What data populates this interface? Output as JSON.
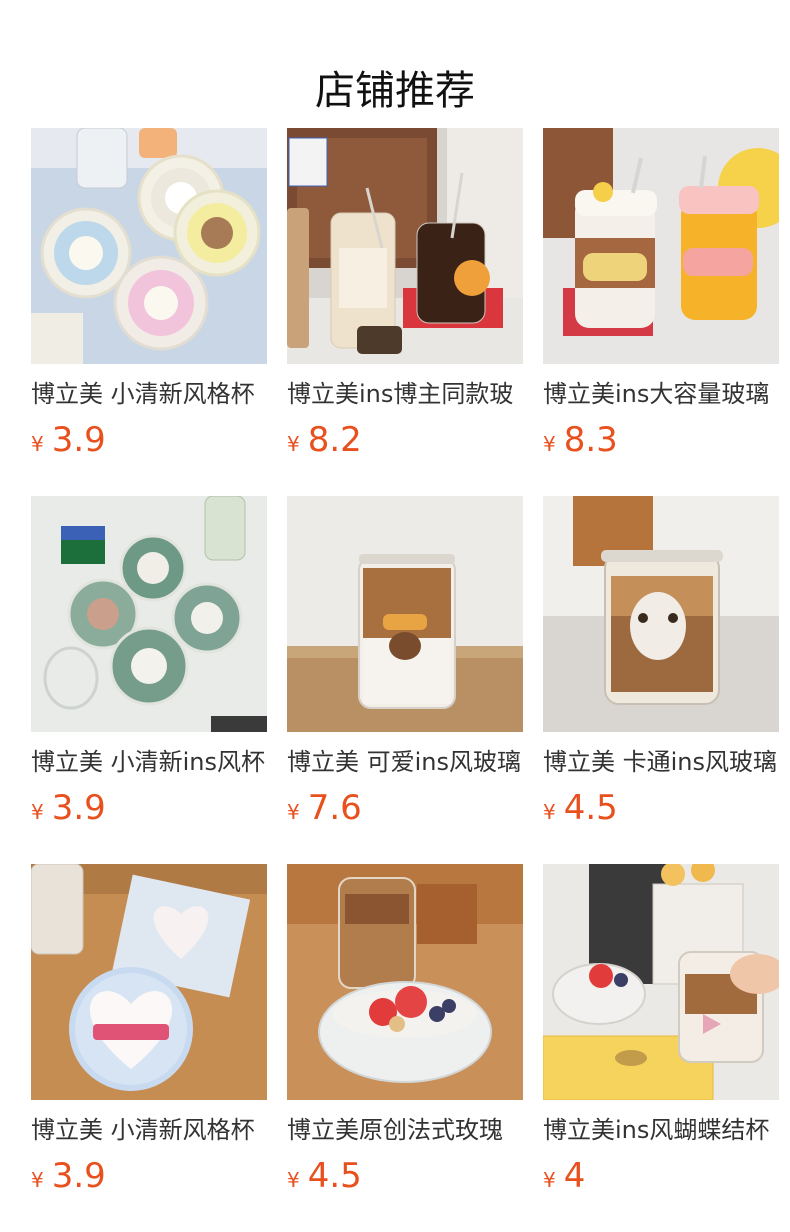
{
  "header": {
    "title": "店铺推荐"
  },
  "currency_symbol": "¥",
  "products": [
    {
      "name": "博立美 小清新风格杯",
      "price": "3.9",
      "image": "coasters-bear-pastel"
    },
    {
      "name": "博立美ins博主同款玻",
      "price": "8.2",
      "image": "glass-bottles-straw"
    },
    {
      "name": "博立美ins大容量玻璃",
      "price": "8.3",
      "image": "ohoh-lettering-cups"
    },
    {
      "name": "博立美 小清新ins风杯",
      "price": "3.9",
      "image": "coasters-green-dogs"
    },
    {
      "name": "博立美 可爱ins风玻璃",
      "price": "7.6",
      "image": "glass-puppy-latte"
    },
    {
      "name": "博立美 卡通ins风玻璃",
      "price": "4.5",
      "image": "glass-upside-dog"
    },
    {
      "name": "博立美 小清新风格杯",
      "price": "3.9",
      "image": "coasters-gingham-heart"
    },
    {
      "name": "博立美原创法式玫瑰",
      "price": "4.5",
      "image": "glass-bowl-strawberry"
    },
    {
      "name": "博立美ins风蝴蝶结杯",
      "price": "4",
      "image": "bow-glass-tulips"
    }
  ]
}
